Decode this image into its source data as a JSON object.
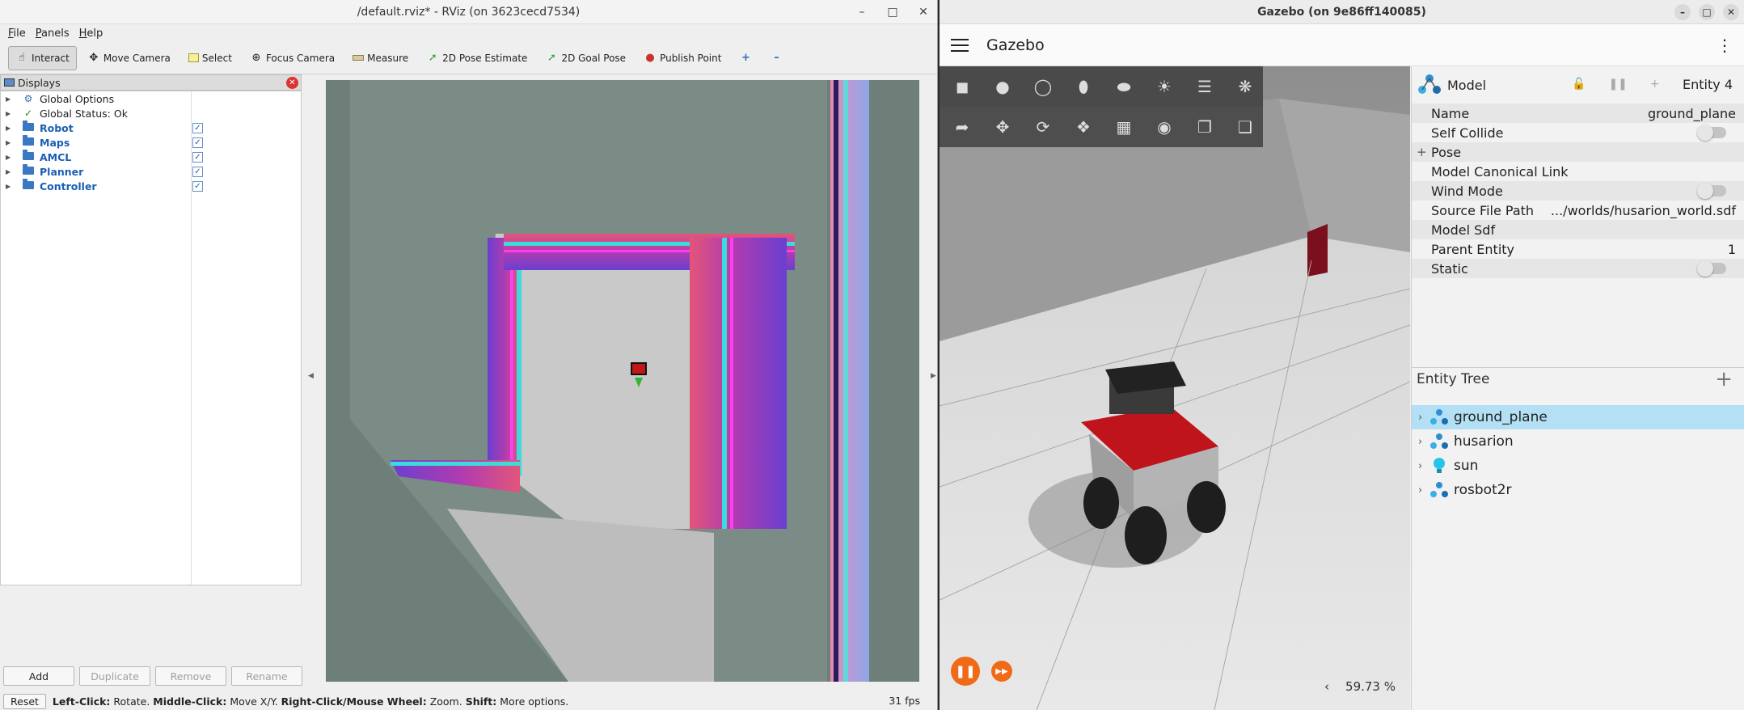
{
  "rviz": {
    "title": "/default.rviz* - RViz (on 3623cecd7534)",
    "menu": [
      "File",
      "Panels",
      "Help"
    ],
    "tools": [
      "Interact",
      "Move Camera",
      "Select",
      "Focus Camera",
      "Measure",
      "2D Pose Estimate",
      "2D Goal Pose",
      "Publish Point"
    ],
    "displays_title": "Displays",
    "tree": [
      {
        "label": "Global Options",
        "bold": false,
        "checked": null
      },
      {
        "label": "Global Status: Ok",
        "bold": false,
        "checked": null
      },
      {
        "label": "Robot",
        "bold": true,
        "checked": true
      },
      {
        "label": "Maps",
        "bold": true,
        "checked": true
      },
      {
        "label": "AMCL",
        "bold": true,
        "checked": true
      },
      {
        "label": "Planner",
        "bold": true,
        "checked": true
      },
      {
        "label": "Controller",
        "bold": true,
        "checked": true
      }
    ],
    "buttons": {
      "add": "Add",
      "duplicate": "Duplicate",
      "remove": "Remove",
      "rename": "Rename"
    },
    "status": {
      "reset": "Reset",
      "k1": "Left-Click:",
      "v1": " Rotate. ",
      "k2": "Middle-Click:",
      "v2": " Move X/Y. ",
      "k3": "Right-Click/Mouse Wheel:",
      "v3": " Zoom. ",
      "k4": "Shift:",
      "v4": " More options.",
      "fps": "31 fps"
    }
  },
  "gazebo": {
    "title": "Gazebo (on 9e86ff140085)",
    "app_title": "Gazebo",
    "component": {
      "label": "Model",
      "entity": "Entity 4"
    },
    "props": {
      "name_label": "Name",
      "name_value": "ground_plane",
      "self_collide": "Self Collide",
      "pose": "Pose",
      "canonical": "Model Canonical Link",
      "wind": "Wind Mode",
      "source_label": "Source File Path",
      "source_value": ".../worlds/husarion_world.sdf",
      "sdf": "Model Sdf",
      "parent_label": "Parent Entity",
      "parent_value": "1",
      "static": "Static"
    },
    "entity_tree_title": "Entity Tree",
    "entities": [
      "ground_plane",
      "husarion",
      "sun",
      "rosbot2r"
    ],
    "rtf": "59.73 %"
  },
  "colors": {
    "rviz_bg": "#6d7f78",
    "costmap_light": "#c8c8c8",
    "gazebo_accent": "#f06a18",
    "selection": "#b3e0f5"
  }
}
